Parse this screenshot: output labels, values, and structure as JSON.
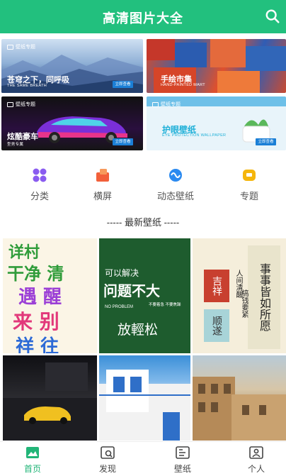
{
  "header": {
    "title": "高清图片大全",
    "search_icon": "search-icon"
  },
  "banners": [
    {
      "tag": "壁纸专题",
      "title": "苍穹之下，同呼吸",
      "subtitle": "THE SAME BREATH",
      "button": "立即查看"
    },
    {
      "tag": "",
      "title": "手绘市集",
      "subtitle": "HAND-PAINTED MART",
      "button": ""
    },
    {
      "tag": "壁纸专题",
      "title": "炫酷豪车",
      "subtitle": "型男专属",
      "button": "立即查看"
    },
    {
      "tag": "壁纸专题",
      "title": "护眼壁纸",
      "subtitle": "EYE PROTECTION WALLPAPER",
      "button": "立即查看"
    }
  ],
  "categories": [
    {
      "label": "分类",
      "icon": "grid-icon",
      "color": "#8a5cf0"
    },
    {
      "label": "横屏",
      "icon": "landscape-icon",
      "color": "#f2603a"
    },
    {
      "label": "动态壁纸",
      "icon": "dynamic-icon",
      "color": "#2b8af0"
    },
    {
      "label": "专题",
      "icon": "topic-icon",
      "color": "#f5b60c"
    }
  ],
  "section_title": "----- 最新壁纸 -----",
  "wallpapers": {
    "w1": {
      "lines": [
        "详村",
        "干净 清",
        "遇 醒",
        "来 别",
        "祥 往"
      ]
    },
    "w2": {
      "line1": "可以解决",
      "line2": "问题不大",
      "line3": "NO PROBLEM",
      "line3b": "不要着急 不要焦躁",
      "line4": "放輕松"
    },
    "w3": {
      "line1": "吉祥",
      "line2": "顺遂",
      "col1": "事事皆如所愿",
      "col2": "人间清醒",
      "col3": "搞钱要紧"
    }
  },
  "bottom_nav": [
    {
      "label": "首页",
      "icon": "image-icon",
      "active": true
    },
    {
      "label": "发现",
      "icon": "discover-icon",
      "active": false
    },
    {
      "label": "壁纸",
      "icon": "wallpaper-icon",
      "active": false
    },
    {
      "label": "个人",
      "icon": "user-icon",
      "active": false
    }
  ],
  "colors": {
    "brand": "#22c07e",
    "active_nav": "#22b578"
  }
}
